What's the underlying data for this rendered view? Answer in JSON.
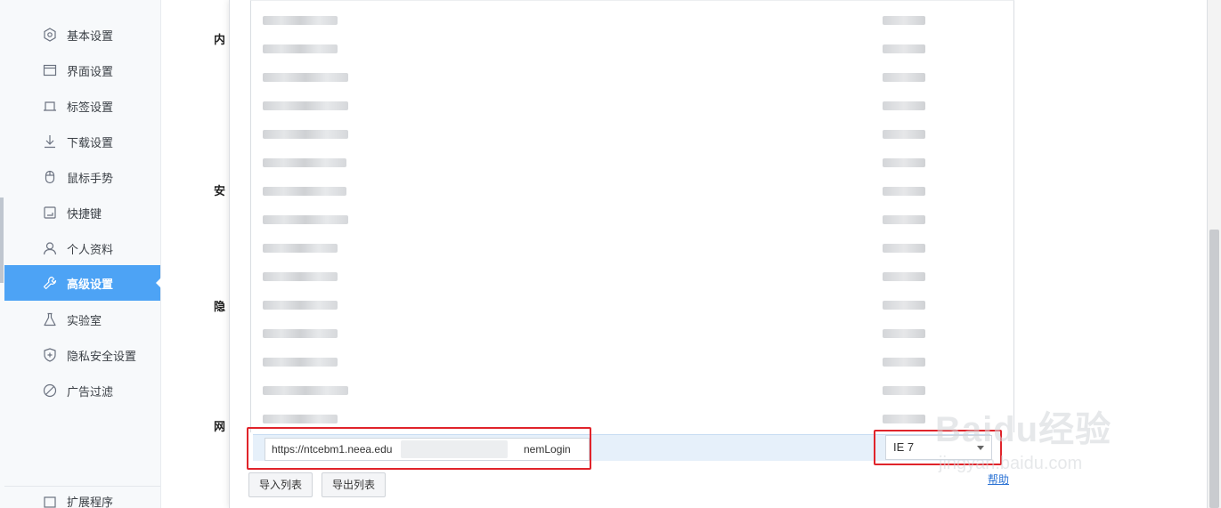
{
  "sidebar": {
    "items": [
      {
        "label": "基本设置",
        "icon": "hexagon-settings-icon"
      },
      {
        "label": "界面设置",
        "icon": "window-icon"
      },
      {
        "label": "标签设置",
        "icon": "tab-icon"
      },
      {
        "label": "下载设置",
        "icon": "download-icon"
      },
      {
        "label": "鼠标手势",
        "icon": "mouse-icon"
      },
      {
        "label": "快捷键",
        "icon": "keyboard-icon"
      },
      {
        "label": "个人资料",
        "icon": "user-icon"
      },
      {
        "label": "高级设置",
        "icon": "wrench-icon",
        "active": true
      },
      {
        "label": "实验室",
        "icon": "flask-icon"
      },
      {
        "label": "隐私安全设置",
        "icon": "shield-icon"
      },
      {
        "label": "广告过滤",
        "icon": "block-icon"
      }
    ],
    "extensions_label": "扩展程序",
    "active_color": "#4da3f5"
  },
  "page": {
    "sections": [
      "内",
      "安",
      "隐",
      "网"
    ]
  },
  "dialog": {
    "edit_url": "https://ntcebm1.neea.edu",
    "edit_url_suffix": "nemLogin",
    "mode_value": "IE 7",
    "import_label": "导入列表",
    "export_label": "导出列表",
    "help_label": "帮助",
    "highlight_color": "#e0242b"
  },
  "watermark": {
    "brand": "Baidu经验",
    "url": "jingyan.baidu.com"
  }
}
